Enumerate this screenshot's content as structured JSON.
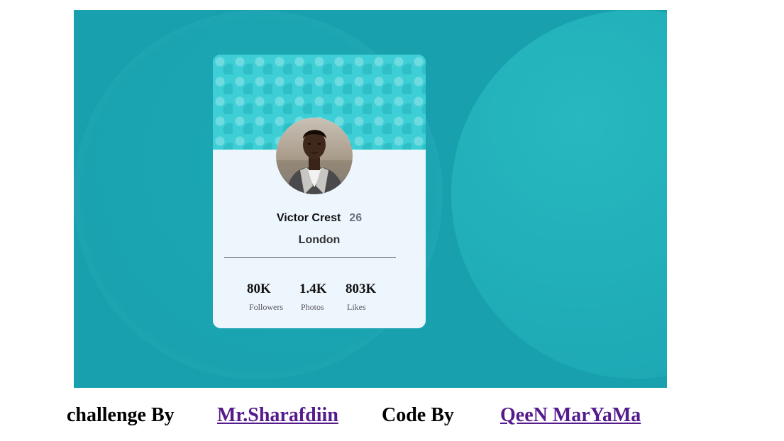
{
  "profile": {
    "name": "Victor Crest",
    "age": "26",
    "city": "London"
  },
  "stats": [
    {
      "value": "80K",
      "label": "Followers"
    },
    {
      "value": "1.4K",
      "label": "Photos"
    },
    {
      "value": "803K",
      "label": "Likes"
    }
  ],
  "footer": {
    "challenge_label": "challenge By",
    "challenge_author": "Mr.Sharafdiin",
    "code_label": "Code By",
    "code_author": "QeeN MarYaMa"
  },
  "colors": {
    "background": "#19a0af",
    "card": "#eef6fd",
    "card_top": "#3ecfd6",
    "link": "#551a8b"
  }
}
